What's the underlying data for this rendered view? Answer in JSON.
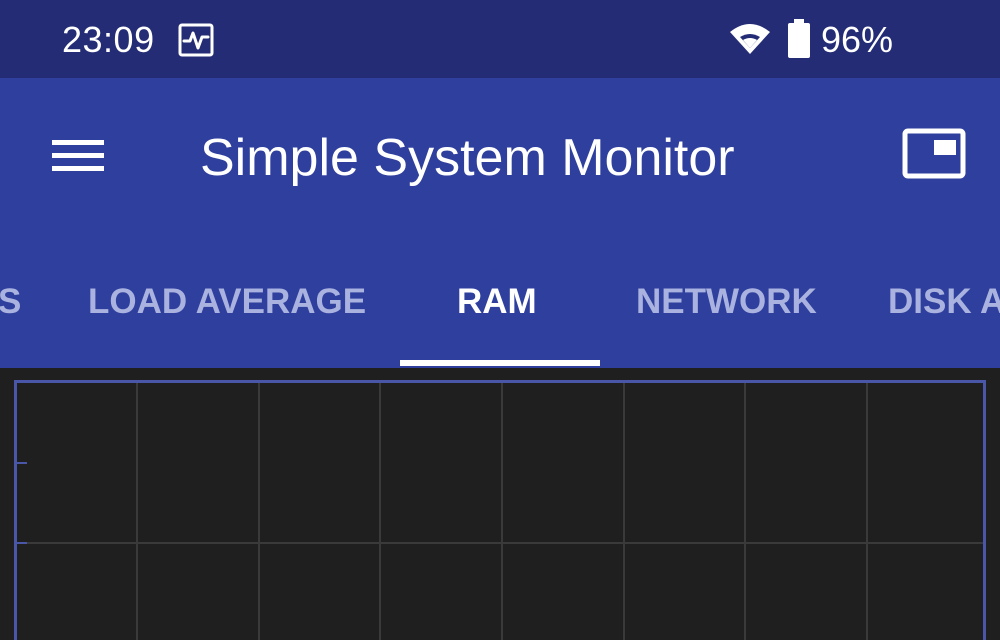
{
  "status_bar": {
    "time": "23:09",
    "battery_text": "96%",
    "icons": [
      "activity-monitor-icon",
      "wifi-icon",
      "battery-icon"
    ]
  },
  "app_bar": {
    "title": "Simple System Monitor",
    "menu_icon": "hamburger-menu-icon",
    "action_icon": "picture-in-picture-icon"
  },
  "tabs": [
    {
      "label": "S",
      "active": false
    },
    {
      "label": "LOAD AVERAGE",
      "active": false
    },
    {
      "label": "RAM",
      "active": true
    },
    {
      "label": "NETWORK",
      "active": false
    },
    {
      "label": "DISK A",
      "active": false
    }
  ],
  "colors": {
    "status_bar": "#232c75",
    "app_bar": "#2f3f9e",
    "inactive_tab": "#aab2df",
    "active_tab": "#ffffff",
    "graph_background": "#1f1f1f",
    "graph_border": "#4a56a8",
    "grid_line": "#3a3a3a"
  },
  "graph": {
    "vertical_divisions": 8,
    "horizontal_divisions": 2
  }
}
